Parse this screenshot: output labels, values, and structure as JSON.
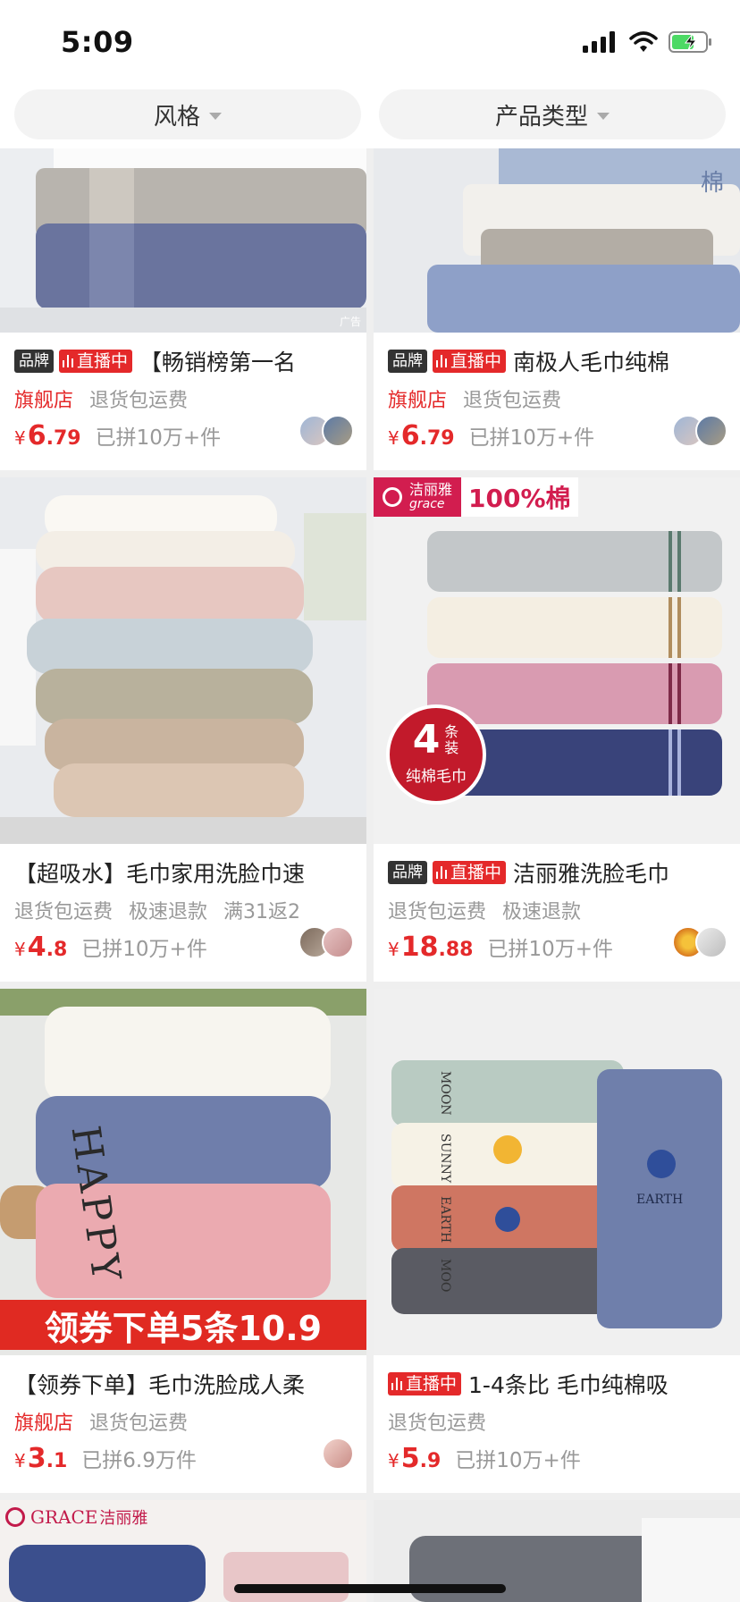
{
  "status": {
    "time": "5:09"
  },
  "filters": {
    "style": "风格",
    "type": "产品类型"
  },
  "tags": {
    "brand": "品牌",
    "live": "直播中"
  },
  "cards": [
    {
      "title": "【畅销榜第一名",
      "flagship": "旗舰店",
      "shipping": "退货包运费",
      "price_int": "6",
      "price_dec": ".79",
      "yen": "¥",
      "sold": "已拼10万+件",
      "ad": "广告"
    },
    {
      "title": "南极人毛巾纯棉",
      "flagship": "旗舰店",
      "shipping": "退货包运费",
      "price_int": "6",
      "price_dec": ".79",
      "yen": "¥",
      "sold": "已拼10万+件",
      "badge_text": "棉"
    },
    {
      "title": "【超吸水】毛巾家用洗脸巾速",
      "shipping": "退货包运费",
      "fast_refund": "极速退款",
      "cashback": "满31返2",
      "price_int": "4",
      "price_dec": ".8",
      "yen": "¥",
      "sold": "已拼10万+件"
    },
    {
      "title": "洁丽雅洗脸毛巾",
      "shipping": "退货包运费",
      "fast_refund": "极速退款",
      "price_int": "18",
      "price_dec": ".88",
      "yen": "¥",
      "sold": "已拼10万+件",
      "banner_brand": "洁丽雅",
      "banner_brand_en": "grace",
      "banner_cotton": "100%棉",
      "badge_num": "4",
      "badge_unit": "条装",
      "badge_text": "纯棉毛巾"
    },
    {
      "title": "【领券下单】毛巾洗脸成人柔",
      "flagship": "旗舰店",
      "shipping": "退货包运费",
      "price_int": "3",
      "price_dec": ".1",
      "yen": "¥",
      "sold": "已拼6.9万件",
      "promo": "领券下单5条10.9",
      "towel_text": "HAPPY LI"
    },
    {
      "title": "1-4条比 毛巾纯棉吸",
      "shipping": "退货包运费",
      "price_int": "5",
      "price_dec": ".9",
      "yen": "¥",
      "sold": "已拼10万+件",
      "towel_words": [
        "MOON",
        "SUNNY",
        "EARTH",
        "MOO"
      ],
      "towel_label": "EARTH"
    },
    {
      "logo_en": "GRACE",
      "logo_cn": "洁丽雅"
    },
    {}
  ],
  "colors": {
    "accent": "#e4292a",
    "muted": "#999999",
    "pill": "#f3f3f3"
  }
}
